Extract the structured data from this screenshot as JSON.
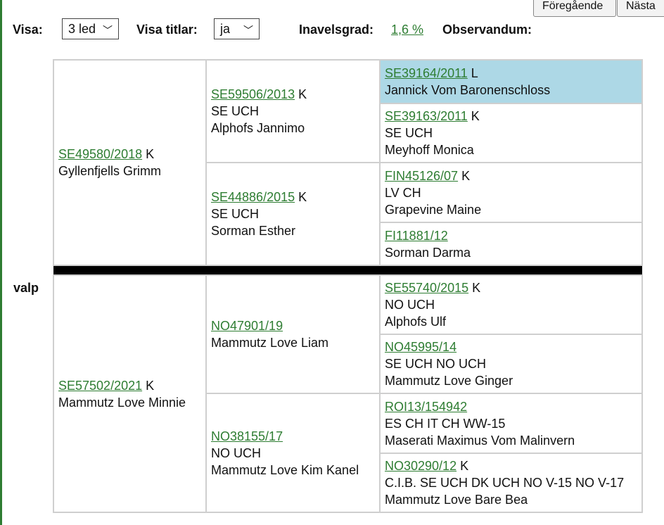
{
  "nav": {
    "prev_label": "Föregående",
    "next_label": "Nästa"
  },
  "controls": {
    "visa_label": "Visa:",
    "visa_value": "3 led",
    "titlar_label": "Visa titlar:",
    "titlar_value": "ja",
    "inavel_label": "Inavelsgrad:",
    "inavel_value": "1,6 %",
    "obs_label": "Observandum:"
  },
  "subject": "valp",
  "pedigree": {
    "sire": {
      "reg": "SE49580/2018",
      "sex": "K",
      "name": "Gyllenfjells Grimm"
    },
    "sire_sire": {
      "reg": "SE59506/2013",
      "sex": "K",
      "titles": "SE UCH",
      "name": "Alphofs Jannimo"
    },
    "sire_sire_sire": {
      "reg": "SE39164/2011",
      "sex": "L",
      "name": "Jannick Vom Baronenschloss"
    },
    "sire_sire_dam": {
      "reg": "SE39163/2011",
      "sex": "K",
      "titles": "SE UCH",
      "name": "Meyhoff Monica"
    },
    "sire_dam": {
      "reg": "SE44886/2015",
      "sex": "K",
      "titles": "SE UCH",
      "name": "Sorman Esther"
    },
    "sire_dam_sire": {
      "reg": "FIN45126/07",
      "sex": "K",
      "titles": "LV CH",
      "name": "Grapevine Maine"
    },
    "sire_dam_dam": {
      "reg": "FI11881/12",
      "name": "Sorman Darma"
    },
    "dam": {
      "reg": "SE57502/2021",
      "sex": "K",
      "name": "Mammutz Love Minnie"
    },
    "dam_sire": {
      "reg": "NO47901/19",
      "name": "Mammutz Love Liam"
    },
    "dam_sire_sire": {
      "reg": "SE55740/2015",
      "sex": "K",
      "titles": "NO UCH",
      "name": "Alphofs Ulf"
    },
    "dam_sire_dam": {
      "reg": "NO45995/14",
      "titles": "SE UCH NO UCH",
      "name": "Mammutz Love Ginger"
    },
    "dam_dam": {
      "reg": "NO38155/17",
      "titles": "NO UCH",
      "name": "Mammutz Love Kim Kanel"
    },
    "dam_dam_sire": {
      "reg": "ROI13/154942",
      "titles": "ES CH IT CH WW-15",
      "name": "Maserati Maximus Vom Malinvern"
    },
    "dam_dam_dam": {
      "reg": "NO30290/12",
      "sex": "K",
      "titles": "C.I.B. SE UCH DK UCH NO V-15 NO V-17",
      "name": "Mammutz Love Bare Bea"
    }
  }
}
